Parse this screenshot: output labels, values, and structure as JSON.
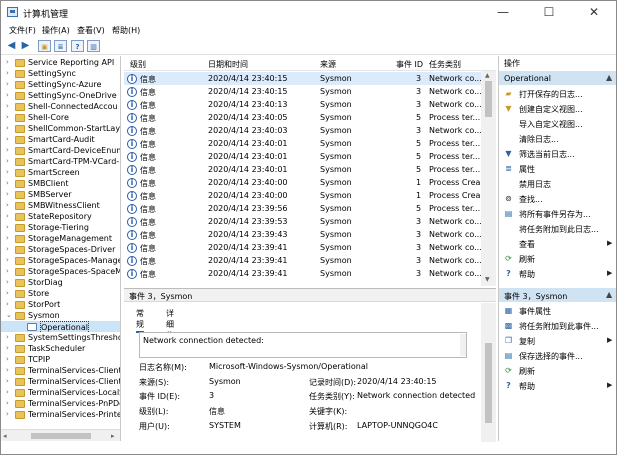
{
  "window": {
    "title": "计算机管理",
    "minimize_glyph": "—",
    "maximize_glyph": "☐",
    "close_glyph": "✕"
  },
  "menu": [
    "文件(F)",
    "操作(A)",
    "查看(V)",
    "帮助(H)"
  ],
  "toolbar": {
    "icons": [
      "back-arrow-icon",
      "forward-arrow-icon",
      "folder-up-icon",
      "properties-icon",
      "help-icon",
      "panel-icon"
    ]
  },
  "tree": {
    "items": [
      {
        "label": "Service Reporting API"
      },
      {
        "label": "SettingSync"
      },
      {
        "label": "SettingSync-Azure"
      },
      {
        "label": "SettingSync-OneDrive"
      },
      {
        "label": "Shell-ConnectedAccou"
      },
      {
        "label": "Shell-Core"
      },
      {
        "label": "ShellCommon-StartLay"
      },
      {
        "label": "SmartCard-Audit"
      },
      {
        "label": "SmartCard-DeviceEnum"
      },
      {
        "label": "SmartCard-TPM-VCard-"
      },
      {
        "label": "SmartScreen"
      },
      {
        "label": "SMBClient"
      },
      {
        "label": "SMBServer"
      },
      {
        "label": "SMBWitnessClient"
      },
      {
        "label": "StateRepository"
      },
      {
        "label": "Storage-Tiering"
      },
      {
        "label": "StorageManagement"
      },
      {
        "label": "StorageSpaces-Driver"
      },
      {
        "label": "StorageSpaces-Manage"
      },
      {
        "label": "StorageSpaces-SpaceM"
      },
      {
        "label": "StorDiag"
      },
      {
        "label": "Store"
      },
      {
        "label": "StorPort"
      },
      {
        "label": "Sysmon"
      },
      {
        "label": "Operational"
      },
      {
        "label": "SystemSettingsThreshol"
      },
      {
        "label": "TaskScheduler"
      },
      {
        "label": "TCPIP"
      },
      {
        "label": "TerminalServices-Client"
      },
      {
        "label": "TerminalServices-Client"
      },
      {
        "label": "TerminalServices-LocalS"
      },
      {
        "label": "TerminalServices-PnPDe"
      },
      {
        "label": "TerminalServices-Printe"
      }
    ]
  },
  "events": {
    "columns": [
      "级别",
      "日期和时间",
      "来源",
      "事件 ID",
      "任务类别"
    ],
    "rows": [
      {
        "level": "信息",
        "datetime": "2020/4/14 23:40:15",
        "source": "Sysmon",
        "id": "3",
        "task": "Network co..."
      },
      {
        "level": "信息",
        "datetime": "2020/4/14 23:40:15",
        "source": "Sysmon",
        "id": "3",
        "task": "Network co..."
      },
      {
        "level": "信息",
        "datetime": "2020/4/14 23:40:13",
        "source": "Sysmon",
        "id": "3",
        "task": "Network co..."
      },
      {
        "level": "信息",
        "datetime": "2020/4/14 23:40:05",
        "source": "Sysmon",
        "id": "5",
        "task": "Process ter..."
      },
      {
        "level": "信息",
        "datetime": "2020/4/14 23:40:03",
        "source": "Sysmon",
        "id": "3",
        "task": "Network co..."
      },
      {
        "level": "信息",
        "datetime": "2020/4/14 23:40:01",
        "source": "Sysmon",
        "id": "5",
        "task": "Process ter..."
      },
      {
        "level": "信息",
        "datetime": "2020/4/14 23:40:01",
        "source": "Sysmon",
        "id": "5",
        "task": "Process ter..."
      },
      {
        "level": "信息",
        "datetime": "2020/4/14 23:40:01",
        "source": "Sysmon",
        "id": "5",
        "task": "Process ter..."
      },
      {
        "level": "信息",
        "datetime": "2020/4/14 23:40:00",
        "source": "Sysmon",
        "id": "1",
        "task": "Process Crea..."
      },
      {
        "level": "信息",
        "datetime": "2020/4/14 23:40:00",
        "source": "Sysmon",
        "id": "1",
        "task": "Process Crea..."
      },
      {
        "level": "信息",
        "datetime": "2020/4/14 23:39:56",
        "source": "Sysmon",
        "id": "5",
        "task": "Process ter..."
      },
      {
        "level": "信息",
        "datetime": "2020/4/14 23:39:53",
        "source": "Sysmon",
        "id": "3",
        "task": "Network co..."
      },
      {
        "level": "信息",
        "datetime": "2020/4/14 23:39:43",
        "source": "Sysmon",
        "id": "3",
        "task": "Network co..."
      },
      {
        "level": "信息",
        "datetime": "2020/4/14 23:39:41",
        "source": "Sysmon",
        "id": "3",
        "task": "Network co..."
      },
      {
        "level": "信息",
        "datetime": "2020/4/14 23:39:41",
        "source": "Sysmon",
        "id": "3",
        "task": "Network co..."
      },
      {
        "level": "信息",
        "datetime": "2020/4/14 23:39:41",
        "source": "Sysmon",
        "id": "3",
        "task": "Network co..."
      }
    ]
  },
  "detail": {
    "header": "事件 3，Sysmon",
    "close_glyph": "×",
    "tabs": [
      "常规",
      "详细信息"
    ],
    "description": "Network connection detected:",
    "fields": {
      "log_name_label": "日志名称(M):",
      "log_name": "Microsoft-Windows-Sysmon/Operational",
      "source_label": "来源(S):",
      "source": "Sysmon",
      "logged_label": "记录时间(D):",
      "logged": "2020/4/14 23:40:15",
      "event_id_label": "事件 ID(E):",
      "event_id": "3",
      "task_label": "任务类别(Y):",
      "task": "Network connection detected (ru",
      "level_label": "级别(L):",
      "level": "信息",
      "keywords_label": "关键字(K):",
      "keywords": "",
      "user_label": "用户(U):",
      "user": "SYSTEM",
      "computer_label": "计算机(R):",
      "computer": "LAPTOP-UNNQGO4C"
    }
  },
  "actions": {
    "header": "操作",
    "group1": "Operational",
    "group1_items": [
      {
        "label": "打开保存的日志...",
        "icon": "folder-open-icon"
      },
      {
        "label": "创建自定义视图...",
        "icon": "filter-add-icon"
      },
      {
        "label": "导入自定义视图...",
        "icon": "import-icon"
      },
      {
        "label": "清除日志...",
        "icon": "blank-icon"
      },
      {
        "label": "筛选当前日志...",
        "icon": "filter-icon"
      },
      {
        "label": "属性",
        "icon": "properties-icon"
      },
      {
        "label": "禁用日志",
        "icon": "blank-icon"
      },
      {
        "label": "查找...",
        "icon": "binoculars-icon"
      },
      {
        "label": "将所有事件另存为...",
        "icon": "save-icon"
      },
      {
        "label": "将任务附加到此日志...",
        "icon": "blank-icon"
      },
      {
        "label": "查看",
        "icon": "blank-icon",
        "submenu": true
      },
      {
        "label": "刷新",
        "icon": "refresh-icon"
      },
      {
        "label": "帮助",
        "icon": "help-icon",
        "submenu": true
      }
    ],
    "group2": "事件 3，Sysmon",
    "group2_items": [
      {
        "label": "事件属性",
        "icon": "event-properties-icon"
      },
      {
        "label": "将任务附加到此事件...",
        "icon": "task-icon"
      },
      {
        "label": "复制",
        "icon": "copy-icon",
        "submenu": true
      },
      {
        "label": "保存选择的事件...",
        "icon": "save-icon"
      },
      {
        "label": "刷新",
        "icon": "refresh-icon"
      },
      {
        "label": "帮助",
        "icon": "help-icon",
        "submenu": true
      }
    ]
  }
}
